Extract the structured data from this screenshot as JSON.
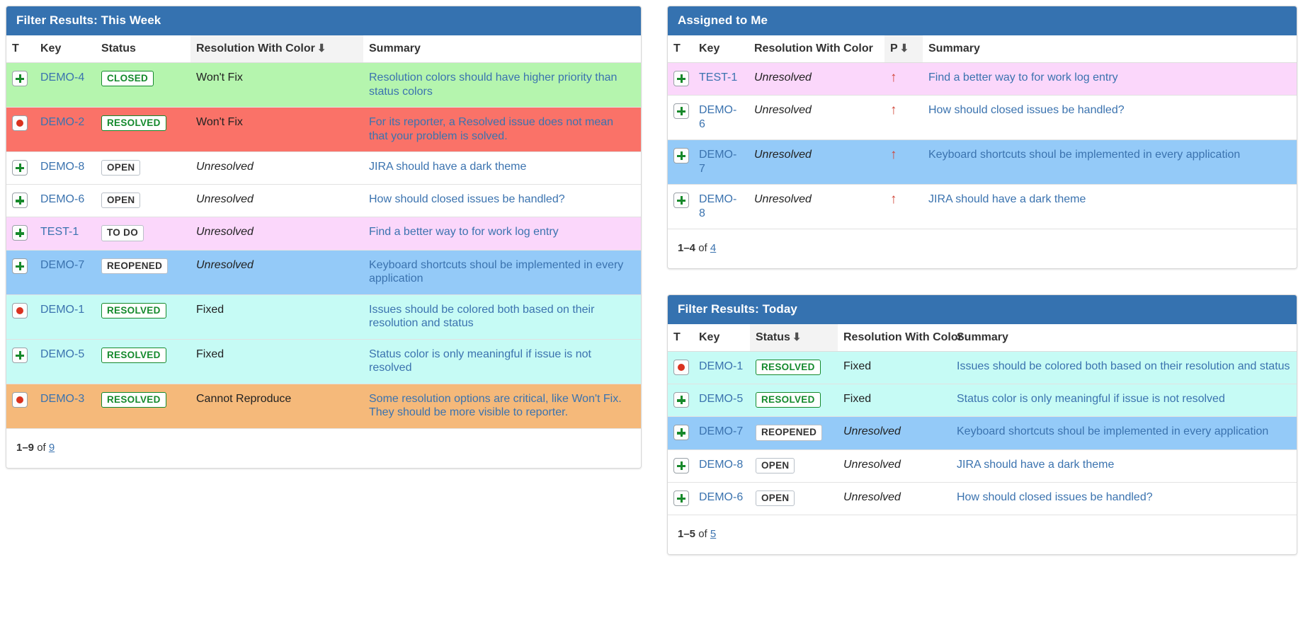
{
  "panels": {
    "this_week": {
      "title": "Filter Results: This Week",
      "columns": {
        "type": "T",
        "key": "Key",
        "status": "Status",
        "resolution": "Resolution With Color",
        "summary": "Summary"
      },
      "sorted_column": "resolution",
      "sort_direction_icon": "⬇",
      "rows": [
        {
          "type_icon": "feature-icon",
          "key": "DEMO-4",
          "status": "CLOSED",
          "status_style": "green",
          "resolution": "Won't Fix",
          "resolved": true,
          "summary": "Resolution colors should have higher priority than status colors",
          "row_color": "green"
        },
        {
          "type_icon": "bug-icon",
          "key": "DEMO-2",
          "status": "RESOLVED",
          "status_style": "green",
          "resolution": "Won't Fix",
          "resolved": true,
          "summary": "For its reporter, a Resolved issue does not mean that your problem is solved.",
          "row_color": "red"
        },
        {
          "type_icon": "feature-icon",
          "key": "DEMO-8",
          "status": "OPEN",
          "status_style": "grey",
          "resolution": "Unresolved",
          "resolved": false,
          "summary": "JIRA should have a dark theme",
          "row_color": "white"
        },
        {
          "type_icon": "feature-icon",
          "key": "DEMO-6",
          "status": "OPEN",
          "status_style": "grey",
          "resolution": "Unresolved",
          "resolved": false,
          "summary": "How should closed issues be handled?",
          "row_color": "white"
        },
        {
          "type_icon": "feature-icon",
          "key": "TEST-1",
          "status": "TO DO",
          "status_style": "grey",
          "resolution": "Unresolved",
          "resolved": false,
          "summary": "Find a better way to for work log entry",
          "row_color": "pink"
        },
        {
          "type_icon": "feature-icon",
          "key": "DEMO-7",
          "status": "REOPENED",
          "status_style": "grey",
          "resolution": "Unresolved",
          "resolved": false,
          "summary": "Keyboard shortcuts shoul be implemented in every application",
          "row_color": "blue"
        },
        {
          "type_icon": "bug-icon",
          "key": "DEMO-1",
          "status": "RESOLVED",
          "status_style": "green",
          "resolution": "Fixed",
          "resolved": true,
          "summary": "Issues should be colored both based on their resolution and status",
          "row_color": "cyan"
        },
        {
          "type_icon": "feature-icon",
          "key": "DEMO-5",
          "status": "RESOLVED",
          "status_style": "green",
          "resolution": "Fixed",
          "resolved": true,
          "summary": "Status color is only meaningful if issue is not resolved",
          "row_color": "cyan"
        },
        {
          "type_icon": "bug-icon",
          "key": "DEMO-3",
          "status": "RESOLVED",
          "status_style": "green",
          "resolution": "Cannot Reproduce",
          "resolved": true,
          "summary": "Some resolution options are critical, like Won't Fix. They should be more visible to reporter.",
          "row_color": "orange"
        }
      ],
      "pager": {
        "range": "1–9",
        "of": "of",
        "total": "9"
      }
    },
    "assigned_to_me": {
      "title": "Assigned to Me",
      "columns": {
        "type": "T",
        "key": "Key",
        "resolution": "Resolution With Color",
        "priority": "P",
        "summary": "Summary"
      },
      "sorted_column": "priority",
      "sort_direction_icon": "⬇",
      "rows": [
        {
          "type_icon": "feature-icon",
          "key": "TEST-1",
          "resolution": "Unresolved",
          "resolved": false,
          "priority_icon": "priority-major-up-arrow",
          "summary": "Find a better way to for work log entry",
          "row_color": "pink"
        },
        {
          "type_icon": "feature-icon",
          "key": "DEMO-6",
          "resolution": "Unresolved",
          "resolved": false,
          "priority_icon": "priority-major-up-arrow",
          "summary": "How should closed issues be handled?",
          "row_color": "white"
        },
        {
          "type_icon": "feature-icon",
          "key": "DEMO-7",
          "resolution": "Unresolved",
          "resolved": false,
          "priority_icon": "priority-major-up-arrow",
          "summary": "Keyboard shortcuts shoul be implemented in every application",
          "row_color": "blue"
        },
        {
          "type_icon": "feature-icon",
          "key": "DEMO-8",
          "resolution": "Unresolved",
          "resolved": false,
          "priority_icon": "priority-major-up-arrow",
          "summary": "JIRA should have a dark theme",
          "row_color": "white"
        }
      ],
      "pager": {
        "range": "1–4",
        "of": "of",
        "total": "4"
      }
    },
    "today": {
      "title": "Filter Results: Today",
      "columns": {
        "type": "T",
        "key": "Key",
        "status": "Status",
        "resolution": "Resolution With Color",
        "summary": "Summary"
      },
      "sorted_column": "status",
      "sort_direction_icon": "⬇",
      "rows": [
        {
          "type_icon": "bug-icon",
          "key": "DEMO-1",
          "status": "RESOLVED",
          "status_style": "green",
          "resolution": "Fixed",
          "resolved": true,
          "summary": "Issues should be colored both based on their resolution and status",
          "row_color": "cyan"
        },
        {
          "type_icon": "feature-icon",
          "key": "DEMO-5",
          "status": "RESOLVED",
          "status_style": "green",
          "resolution": "Fixed",
          "resolved": true,
          "summary": "Status color is only meaningful if issue is not resolved",
          "row_color": "cyan"
        },
        {
          "type_icon": "feature-icon",
          "key": "DEMO-7",
          "status": "REOPENED",
          "status_style": "grey",
          "resolution": "Unresolved",
          "resolved": false,
          "summary": "Keyboard shortcuts shoul be implemented in every application",
          "row_color": "blue"
        },
        {
          "type_icon": "feature-icon",
          "key": "DEMO-8",
          "status": "OPEN",
          "status_style": "grey",
          "resolution": "Unresolved",
          "resolved": false,
          "summary": "JIRA should have a dark theme",
          "row_color": "white"
        },
        {
          "type_icon": "feature-icon",
          "key": "DEMO-6",
          "status": "OPEN",
          "status_style": "grey",
          "resolution": "Unresolved",
          "resolved": false,
          "summary": "How should closed issues be handled?",
          "row_color": "white"
        }
      ],
      "pager": {
        "range": "1–5",
        "of": "of",
        "total": "5"
      }
    }
  },
  "colors": {
    "header_blue": "#3572b0",
    "row_green": "#b5f5ae",
    "row_red": "#fa7268",
    "row_pink": "#fbd7fb",
    "row_blue": "#94caf8",
    "row_cyan": "#c6fbf5",
    "row_orange": "#f5b97a",
    "link_blue": "#3b73af",
    "status_green": "#14892c",
    "priority_red": "#d04437"
  }
}
